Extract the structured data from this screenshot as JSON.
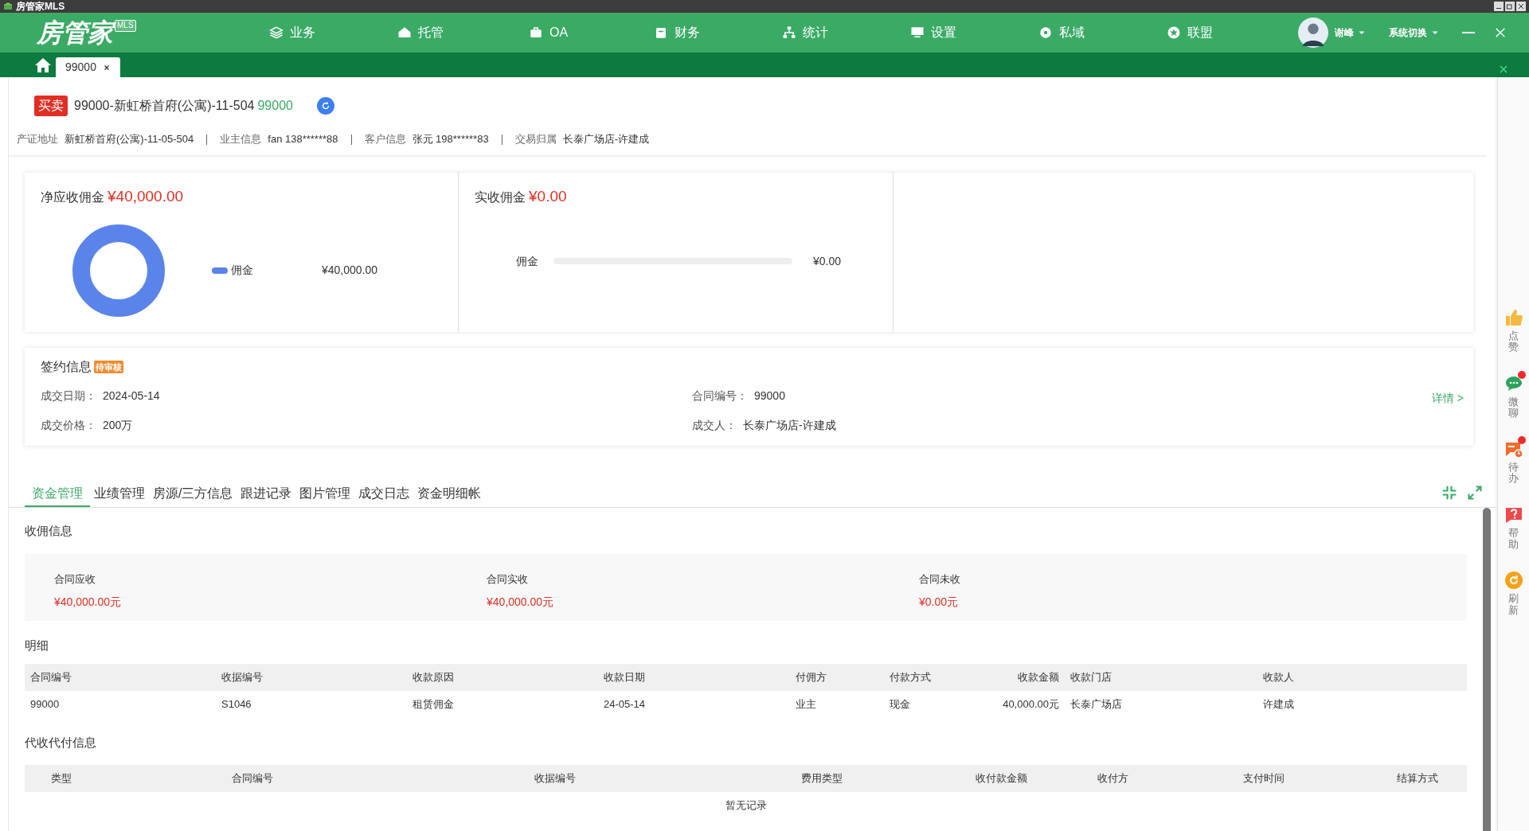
{
  "window": {
    "title": "房管家MLS"
  },
  "brand": {
    "name": "房管家",
    "badge": "MLS"
  },
  "nav": [
    {
      "label": "业务"
    },
    {
      "label": "托管"
    },
    {
      "label": "OA"
    },
    {
      "label": "财务"
    },
    {
      "label": "统计"
    },
    {
      "label": "设置"
    },
    {
      "label": "私域"
    },
    {
      "label": "联盟"
    }
  ],
  "user": {
    "name": "谢峰",
    "switch": "系统切换"
  },
  "doc_tabs": [
    {
      "label": "99000",
      "selected": true
    }
  ],
  "header": {
    "tag": "买卖",
    "title": "99000-新虹桥首府(公寓)-11-504",
    "code": "99000"
  },
  "info": [
    {
      "label": "产证地址",
      "value": "新虹桥首府(公寓)-11-05-504"
    },
    {
      "label": "业主信息",
      "value": "fan  138******88"
    },
    {
      "label": "客户信息",
      "value": "张元  198******83"
    },
    {
      "label": "交易归属",
      "value": "长泰广场店-许建成"
    }
  ],
  "commission": {
    "net_label": "净应收佣金",
    "net_value": "¥40,000.00",
    "legend": [
      {
        "label": "佣金",
        "value": "¥40,000.00",
        "color": "#5b84ea"
      }
    ],
    "received_label": "实收佣金",
    "received_value": "¥0.00",
    "received_rows": [
      {
        "label": "佣金",
        "level": 0,
        "value": "¥0.00"
      }
    ]
  },
  "signing": {
    "title": "签约信息",
    "status": "待审核",
    "detail_link": "详情 >",
    "fields": [
      {
        "label": "成交日期：",
        "value": "2024-05-14"
      },
      {
        "label": "合同编号：",
        "value": "99000"
      },
      {
        "label": "成交价格：",
        "value": "200万"
      },
      {
        "label": "成交人：",
        "value": "长泰广场店-许建成"
      }
    ]
  },
  "tabs": [
    {
      "label": "资金管理",
      "selected": true
    },
    {
      "label": "业绩管理",
      "selected": false
    },
    {
      "label": "房源/三方信息",
      "selected": false
    },
    {
      "label": "跟进记录",
      "selected": false
    },
    {
      "label": "图片管理",
      "selected": false
    },
    {
      "label": "成交日志",
      "selected": false
    },
    {
      "label": "资金明细帐",
      "selected": false
    }
  ],
  "summary": {
    "title": "收佣信息",
    "items": [
      {
        "label": "合同应收",
        "value": "¥40,000.00元"
      },
      {
        "label": "合同实收",
        "value": "¥40,000.00元"
      },
      {
        "label": "合同未收",
        "value": "¥0.00元"
      }
    ]
  },
  "detail": {
    "title": "明细",
    "columns": [
      "合同编号",
      "收据编号",
      "收款原因",
      "收款日期",
      "付佣方",
      "付款方式",
      "收款金额",
      "收款门店",
      "收款人"
    ],
    "rows": [
      [
        "99000",
        "S1046",
        "租赁佣金",
        "24-05-14",
        "业主",
        "现金",
        "40,000.00元",
        "长泰广场店",
        "许建成"
      ]
    ]
  },
  "agency": {
    "title": "代收代付信息",
    "columns": [
      "类型",
      "合同编号",
      "收据编号",
      "费用类型",
      "收付款金额",
      "收付方",
      "支付时间",
      "结算方式"
    ],
    "empty": "暂无记录"
  },
  "side": [
    {
      "label": "点赞",
      "dot": false
    },
    {
      "label": "微聊",
      "dot": true
    },
    {
      "label": "待办",
      "dot": true
    },
    {
      "label": "帮助",
      "dot": false
    },
    {
      "label": "刷新",
      "dot": false
    }
  ]
}
